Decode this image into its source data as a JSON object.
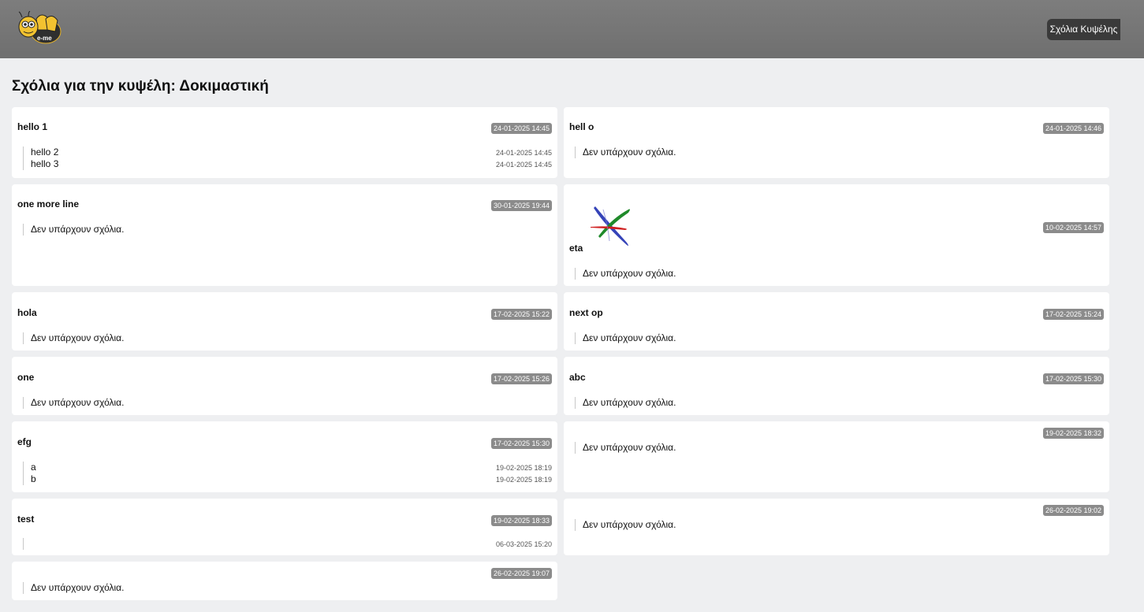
{
  "header": {
    "logo_text": "e-me",
    "hive_comments_button": "Σχόλια Κυψέλης"
  },
  "page": {
    "title": "Σχόλια για την κυψέλη: Δοκιμαστική"
  },
  "no_comments_text": "Δεν υπάρχουν σχόλια.",
  "posts": [
    {
      "title": "hello 1",
      "date": "24-01-2025 14:45",
      "comments": [
        {
          "text": "hello 2",
          "date": "24-01-2025 14:45"
        },
        {
          "text": "hello 3",
          "date": "24-01-2025 14:45"
        }
      ]
    },
    {
      "title": "hell o",
      "date": "24-01-2025 14:46",
      "comments": []
    },
    {
      "title": "one more line",
      "date": "30-01-2025 19:44",
      "comments": []
    },
    {
      "title": "eta",
      "date": "10-02-2025 14:57",
      "comments": [],
      "image": "colorful-strokes-image"
    },
    {
      "title": "hola",
      "date": "17-02-2025 15:22",
      "comments": []
    },
    {
      "title": "next op",
      "date": "17-02-2025 15:24",
      "comments": []
    },
    {
      "title": "one",
      "date": "17-02-2025 15:26",
      "comments": []
    },
    {
      "title": "abc",
      "date": "17-02-2025 15:30",
      "comments": []
    },
    {
      "title": "efg",
      "date": "17-02-2025 15:30",
      "comments": [
        {
          "text": "a",
          "date": "19-02-2025 18:19"
        },
        {
          "text": "b",
          "date": "19-02-2025 18:19"
        }
      ]
    },
    {
      "title": "",
      "date": "19-02-2025 18:32",
      "comments": []
    },
    {
      "title": "test",
      "date": "19-02-2025 18:33",
      "comments": [
        {
          "text": "",
          "date": "06-03-2025 15:20"
        }
      ]
    },
    {
      "title": "",
      "date": "26-02-2025 19:02",
      "comments": []
    },
    {
      "title": "",
      "date": "26-02-2025 19:07",
      "comments": []
    }
  ]
}
